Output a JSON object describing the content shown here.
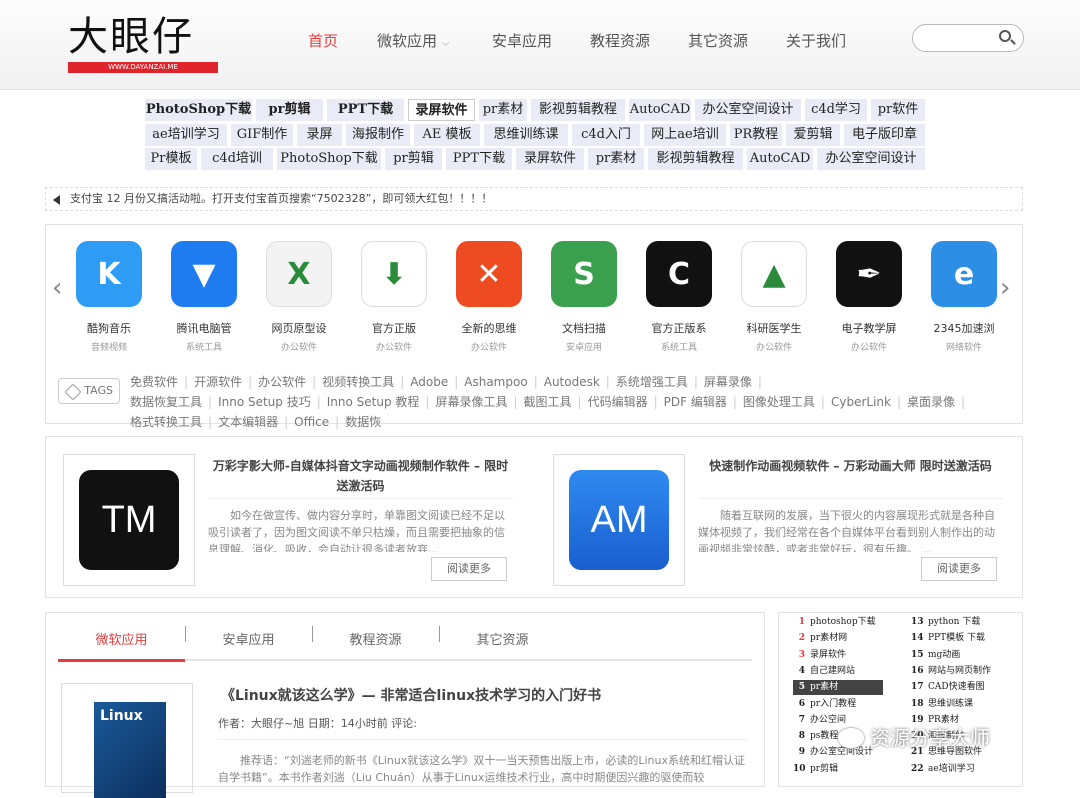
{
  "header": {
    "logo_text": "大眼仔",
    "logo_sub": "WWW.DAYANZAI.ME",
    "nav": [
      "首页",
      "微软应用",
      "安卓应用",
      "教程资源",
      "其它资源",
      "关于我们"
    ],
    "nav_dropdown_icon": "chevron-down-icon",
    "search_placeholder": ""
  },
  "tag_bar": {
    "row1": [
      "PhotoShop下载",
      "pr剪辑",
      "PPT下载",
      "录屏软件",
      "pr素材",
      "影视剪辑教程",
      "AutoCAD",
      "办公室空间设计",
      "c4d学习",
      "pr软件"
    ],
    "row2": [
      "ae培训学习",
      "GIF制作",
      "录屏",
      "海报制作",
      "AE 模板",
      "思维训练课",
      "c4d入门",
      "网上ae培训",
      "PR教程",
      "爱剪辑",
      "电子版印章"
    ],
    "row3": [
      "Pr模板",
      "c4d培训",
      "PhotoShop下载",
      "pr剪辑",
      "PPT下载",
      "录屏软件",
      "pr素材",
      "影视剪辑教程",
      "AutoCAD",
      "办公室空间设计"
    ]
  },
  "notice": {
    "icon": "speaker-icon",
    "text": "支付宝 12 月份又搞活动啦。打开支付宝首页搜索“7502328”，即可领大红包！！！！"
  },
  "apps": [
    {
      "name": "酷狗音乐",
      "category": "音频视频",
      "color": "#2e9cf4",
      "glyph": "K"
    },
    {
      "name": "腾讯电脑管",
      "category": "系统工具",
      "color": "#1e7cf0",
      "glyph": "▼"
    },
    {
      "name": "网页原型设",
      "category": "办公软件",
      "color": "#f3f3f3",
      "glyph": "X"
    },
    {
      "name": "官方正版",
      "category": "办公软件",
      "color": "#ffffff",
      "glyph": "⬇"
    },
    {
      "name": "全新的思维",
      "category": "办公软件",
      "color": "#ef4b22",
      "glyph": "✕"
    },
    {
      "name": "文档扫描",
      "category": "安卓应用",
      "color": "#3aa04e",
      "glyph": "S"
    },
    {
      "name": "官方正版系",
      "category": "系统工具",
      "color": "#111111",
      "glyph": "C"
    },
    {
      "name": "科研医学生",
      "category": "办公软件",
      "color": "#ffffff",
      "glyph": "▲"
    },
    {
      "name": "电子教学屏",
      "category": "办公软件",
      "color": "#111111",
      "glyph": "✒"
    },
    {
      "name": "2345加速浏",
      "category": "网络软件",
      "color": "#2d8ee6",
      "glyph": "e"
    }
  ],
  "tags": {
    "badge": "TAGS",
    "items": [
      "免费软件",
      "开源软件",
      "办公软件",
      "视频转换工具",
      "Adobe",
      "Ashampoo",
      "Autodesk",
      "系统增强工具",
      "屏幕录像",
      "数据恢复工具",
      "Inno Setup 技巧",
      "Inno Setup 教程",
      "屏幕录像工具",
      "截图工具",
      "代码编辑器",
      "PDF 编辑器",
      "图像处理工具",
      "CyberLink",
      "桌面录像",
      "格式转换工具",
      "文本编辑器",
      "Office",
      "数据恢"
    ]
  },
  "posts": [
    {
      "icon_text": "TM",
      "icon_color": "#111111",
      "title": "万彩字影大师-自媒体抖音文字动画视频制作软件 – 限时送激活码",
      "desc": "如今在做宣传、做内容分享时，单靠图文阅读已经不足以吸引读者了，因为图文阅读不单只枯燥，而且需要把抽象的信息理解、消化、吸收，会自动让很多读者放弃...",
      "more": "阅读更多"
    },
    {
      "icon_text": "AM",
      "icon_color": "#1a6ad8",
      "title": "快速制作动画视频软件 – 万彩动画大师 限时送激活码",
      "desc": "随着互联网的发展，当下很火的内容展现形式就是各种自媒体视频了，我们经常在各个自媒体平台看到别人制作出的动画视频非常炫酷，或者非常好玩，很有乐趣。 ...",
      "more": "阅读更多"
    }
  ],
  "tabs": [
    "微软应用",
    "安卓应用",
    "教程资源",
    "其它资源"
  ],
  "article": {
    "cover_text": "Linux",
    "title": "《Linux就该这么学》— 非常适合linux技术学习的入门好书",
    "meta": "作者：大眼仔~旭 日期：14小时前 评论:",
    "desc": "推荐语：“刘遄老师的新书《Linux就该这么学》双十一当天预售出版上市，必读的Linux系统和红帽认证自学书籍”。本书作者刘遄（Liu Chuán）从事于Linux运维技术行业，高中时期便因兴趣的驱使而较"
  },
  "ranking": {
    "left": [
      {
        "n": "1",
        "t": "photoshop下载"
      },
      {
        "n": "2",
        "t": "pr素材网"
      },
      {
        "n": "3",
        "t": "录屏软件"
      },
      {
        "n": "4",
        "t": "自己建网站"
      },
      {
        "n": "5",
        "t": "pr素材"
      },
      {
        "n": "6",
        "t": "pr入门教程"
      },
      {
        "n": "7",
        "t": "办公空间"
      },
      {
        "n": "8",
        "t": "ps教程"
      },
      {
        "n": "9",
        "t": "办公室空间设计"
      },
      {
        "n": "10",
        "t": "pr剪辑"
      }
    ],
    "right": [
      {
        "n": "13",
        "t": "python 下载"
      },
      {
        "n": "14",
        "t": "PPT模板 下载"
      },
      {
        "n": "15",
        "t": "mg动画"
      },
      {
        "n": "16",
        "t": "网站与网页制作"
      },
      {
        "n": "17",
        "t": "CAD快速看图"
      },
      {
        "n": "18",
        "t": "思维训练课"
      },
      {
        "n": "19",
        "t": "PR素材"
      },
      {
        "n": "20",
        "t": "海报制作"
      },
      {
        "n": "21",
        "t": "思维导图软件"
      },
      {
        "n": "22",
        "t": "ae培训学习"
      }
    ]
  },
  "watermark": "资源分享大师",
  "colors": {
    "accent": "#e23c3c",
    "tag_bg": "#e9ecf6"
  }
}
